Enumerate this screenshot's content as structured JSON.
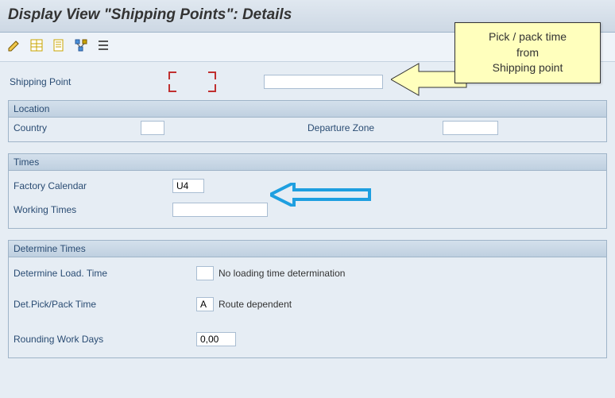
{
  "title": "Display View \"Shipping Points\": Details",
  "toolbar_icons": [
    "edit-icon",
    "table-icon",
    "doc-icon",
    "hier-icon",
    "list-icon"
  ],
  "callout": {
    "line1": "Pick / pack time",
    "line2": "from",
    "line3": "Shipping point"
  },
  "top_row": {
    "shipping_point_label": "Shipping Point",
    "shipping_point_code": "",
    "shipping_point_desc": ""
  },
  "location": {
    "header": "Location",
    "country_label": "Country",
    "country_value": "",
    "departure_zone_label": "Departure Zone",
    "departure_zone_value": ""
  },
  "times": {
    "header": "Times",
    "factory_calendar_label": "Factory Calendar",
    "factory_calendar_value": "U4",
    "working_times_label": "Working Times",
    "working_times_value": ""
  },
  "determine": {
    "header": "Determine Times",
    "load_time_label": "Determine Load. Time",
    "load_time_code": "",
    "load_time_text": "No loading time determination",
    "pickpack_label": "Det.Pick/Pack Time",
    "pickpack_code": "A",
    "pickpack_text": "Route dependent",
    "rounding_label": "Rounding Work Days",
    "rounding_value": "0,00"
  }
}
